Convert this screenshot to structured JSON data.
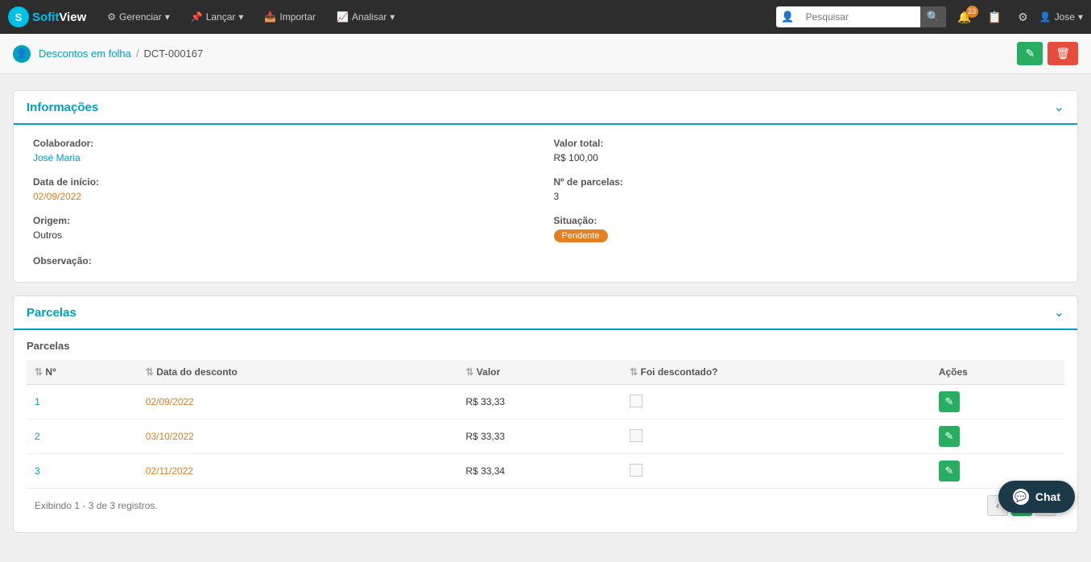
{
  "navbar": {
    "brand_sofit": "Sofit",
    "brand_view": "View",
    "menus": [
      {
        "label": "Gerenciar",
        "icon": "⚙"
      },
      {
        "label": "Lançar",
        "icon": "📌"
      },
      {
        "label": "Importar",
        "icon": "📥"
      },
      {
        "label": "Analisar",
        "icon": "📈"
      }
    ],
    "search_placeholder": "Pesquisar",
    "notification_count": "23",
    "user_label": "Jose"
  },
  "breadcrumb": {
    "parent_label": "Descontos em folha",
    "separator": "/",
    "current": "DCT-000167"
  },
  "action_buttons": {
    "edit_icon": "✎",
    "delete_icon": "🗑"
  },
  "informacoes": {
    "section_title": "Informações",
    "colaborador_label": "Colaborador:",
    "colaborador_value": "José Maria",
    "valor_total_label": "Valor total:",
    "valor_total_value": "R$ 100,00",
    "data_inicio_label": "Data de início:",
    "data_inicio_value": "02/09/2022",
    "num_parcelas_label": "Nº de parcelas:",
    "num_parcelas_value": "3",
    "origem_label": "Origem:",
    "origem_value": "Outros",
    "situacao_label": "Situação:",
    "situacao_value": "Pendente",
    "observacao_label": "Observação:"
  },
  "parcelas": {
    "section_title": "Parcelas",
    "table_title": "Parcelas",
    "columns": {
      "num": "Nº",
      "data_desconto": "Data do desconto",
      "valor": "Valor",
      "foi_descontado": "Foi descontado?",
      "acoes": "Ações"
    },
    "rows": [
      {
        "num": "1",
        "data": "02/09/2022",
        "valor": "R$ 33,33"
      },
      {
        "num": "2",
        "data": "03/10/2022",
        "valor": "R$ 33,33"
      },
      {
        "num": "3",
        "data": "02/11/2022",
        "valor": "R$ 33,34"
      }
    ],
    "footer_text": "Exibindo 1 - 3 de 3 registros.",
    "page_current": "1"
  },
  "chat": {
    "label": "Chat"
  }
}
